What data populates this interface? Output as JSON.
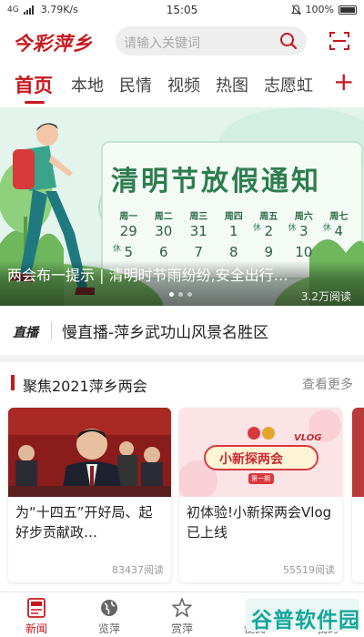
{
  "status_bar": {
    "signal": "4G",
    "speed": "3.79K/s",
    "time": "15:05",
    "battery": "100%"
  },
  "header": {
    "logo_text": "今彩萍乡",
    "search_placeholder": "请输入关键词",
    "icons": [
      "search-icon",
      "scan-icon"
    ]
  },
  "tabs": {
    "items": [
      "首页",
      "本地",
      "民情",
      "视频",
      "热图",
      "志愿虹"
    ],
    "active_index": 0,
    "add_symbol": "+"
  },
  "banner": {
    "notice_title": "清明节放假通知",
    "weekdays": [
      "周一",
      "周二",
      "周三",
      "周四",
      "周五",
      "周六",
      "周七"
    ],
    "row1": [
      "29",
      "30",
      "31",
      "1",
      "2",
      "3",
      "4"
    ],
    "row2": [
      "5",
      "6",
      "7",
      "8",
      "9",
      "10",
      ""
    ],
    "rest_mark": "休",
    "caption": "两会布一提示 | 清明时节雨纷纷,安全出行…",
    "views": "3.2万阅读",
    "slide_count": 3,
    "active_slide": 0
  },
  "live": {
    "tag": "直播",
    "title": "慢直播-萍乡武功山风景名胜区"
  },
  "section": {
    "title": "聚焦2021萍乡两会",
    "more": "查看更多",
    "cards": [
      {
        "title": "为“十四五”开好局、起好步贡献政…",
        "views": "83437阅读"
      },
      {
        "title": "初体验!小新探两会Vlog已上线",
        "views": "55519阅读",
        "image_text": "小新探两会",
        "image_badge": "VLOG",
        "image_episode": "第一期"
      }
    ]
  },
  "bottom_nav": {
    "items": [
      {
        "label": "新闻",
        "icon": "news-icon"
      },
      {
        "label": "览萍",
        "icon": "globe-icon"
      },
      {
        "label": "赏萍",
        "icon": "star-icon"
      },
      {
        "label": "便民",
        "icon": "service-icon"
      },
      {
        "label": "我的",
        "icon": "user-icon"
      }
    ],
    "active_index": 0
  },
  "watermark": "谷普软件园",
  "colors": {
    "brand_red": "#c8171d",
    "banner_green": "#2e7d4f",
    "watermark_teal": "#15a69b"
  }
}
